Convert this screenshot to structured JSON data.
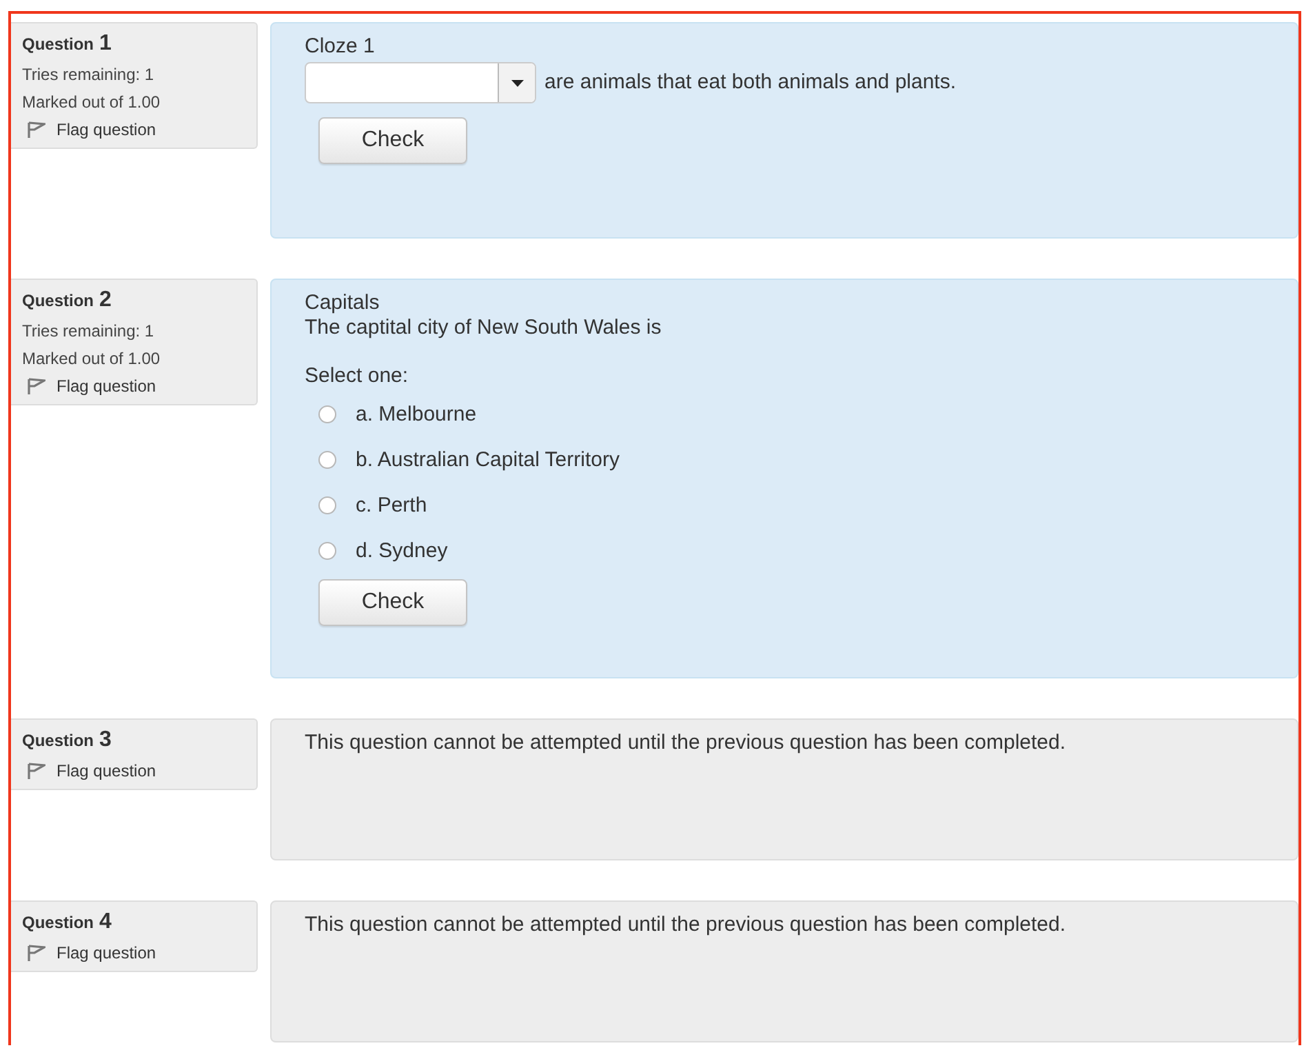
{
  "questions": [
    {
      "label": "Question",
      "number": "1",
      "tries": "Tries remaining: 1",
      "marked": "Marked out of 1.00",
      "flag": "Flag question",
      "flagged": false,
      "kind": "cloze",
      "title": "Cloze 1",
      "after_blank": "are animals that eat both animals and plants.",
      "button": "Check"
    },
    {
      "label": "Question",
      "number": "2",
      "tries": "Tries remaining: 1",
      "marked": "Marked out of 1.00",
      "flag": "Flag question",
      "flagged": false,
      "kind": "multichoice",
      "title": "Capitals",
      "prompt": "The captital city of New South Wales is",
      "select_label": "Select one:",
      "options": [
        {
          "text": "a. Melbourne",
          "selected": false
        },
        {
          "text": "b. Australian Capital Territory",
          "selected": false
        },
        {
          "text": "c. Perth",
          "selected": false
        },
        {
          "text": "d. Sydney",
          "selected": false
        }
      ],
      "button": "Check"
    },
    {
      "label": "Question",
      "number": "3",
      "flag": "Flag question",
      "flagged": false,
      "kind": "locked",
      "message": "This question cannot be attempted until the previous question has been completed."
    },
    {
      "label": "Question",
      "number": "4",
      "flag": "Flag question",
      "flagged": false,
      "kind": "locked",
      "message": "This question cannot be attempted until the previous question has been completed."
    }
  ]
}
